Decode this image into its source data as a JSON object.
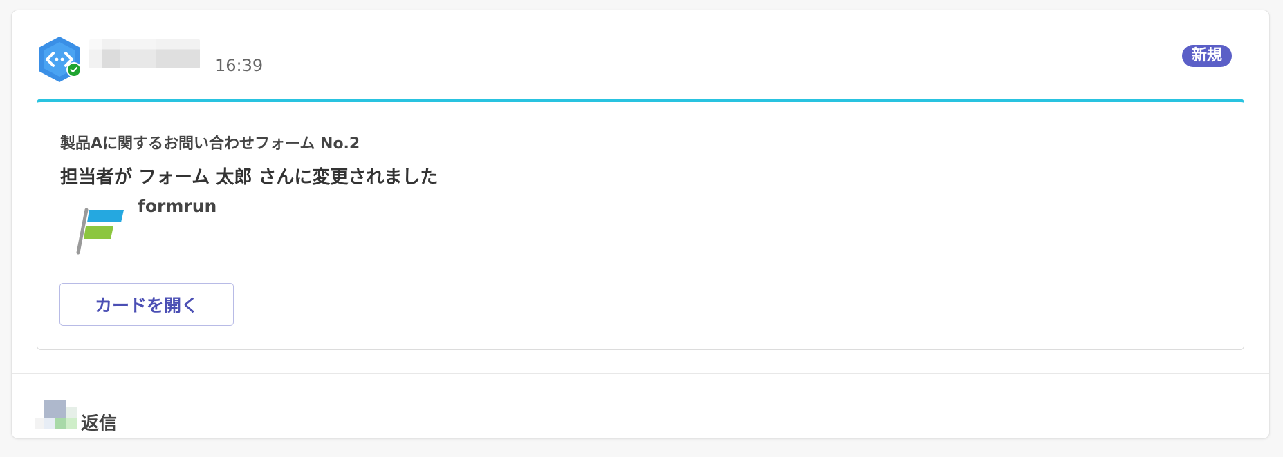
{
  "message": {
    "time": "16:39",
    "badge": "新規"
  },
  "card": {
    "subtitle": "製品Aに関するお問い合わせフォーム No.2",
    "title": "担当者が フォーム 太郎 さんに変更されました",
    "app_name": "formrun",
    "open_button_label": "カードを開く",
    "accent_color": "#29c3e0"
  },
  "reply": {
    "label": "返信"
  },
  "colors": {
    "badge_bg": "#5b5fc7",
    "button_text": "#4b4fb4"
  }
}
